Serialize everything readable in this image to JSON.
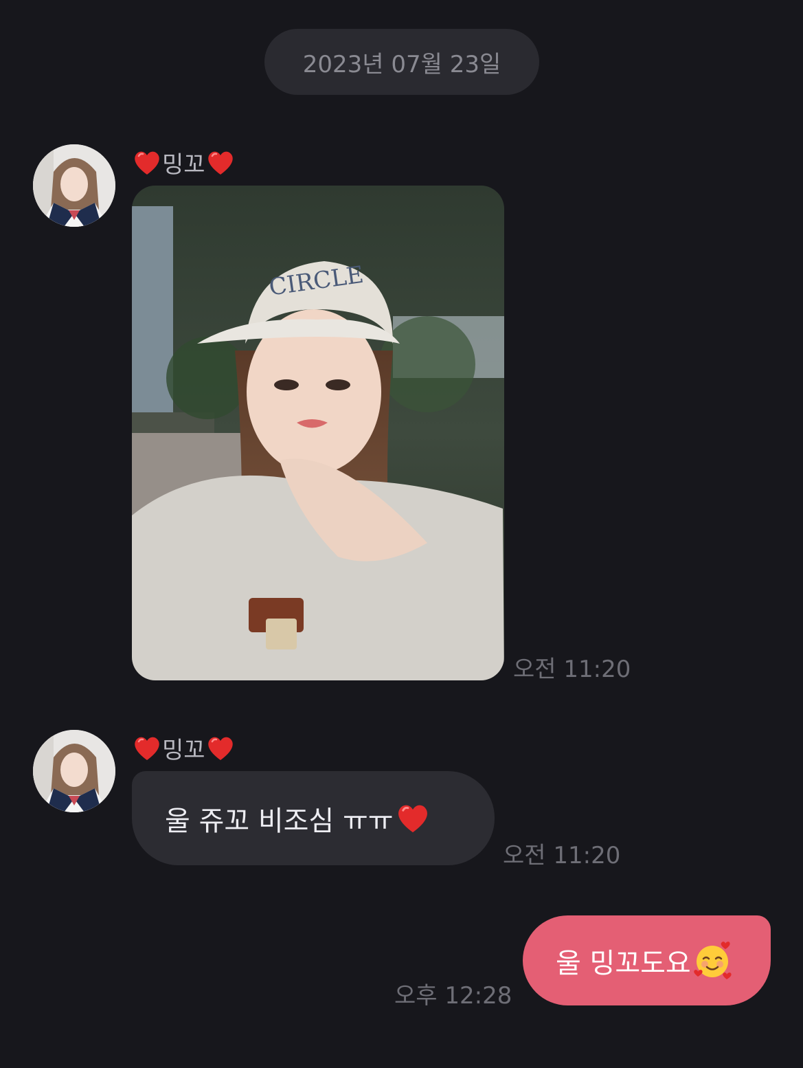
{
  "date_separator": "2023년 07월 23일",
  "messages": [
    {
      "sender": "밍꼬",
      "sender_icons": [
        "red-heart-icon",
        "red-heart-icon"
      ],
      "type": "image",
      "image_description_icon": "photo-thumbnail",
      "time": "오전 11:20"
    },
    {
      "sender": "밍꼬",
      "sender_icons": [
        "red-heart-icon",
        "red-heart-icon"
      ],
      "type": "text",
      "text": "울 쥬꼬 비조심 ㅠㅠ",
      "text_emoji": "red-heart-icon",
      "time": "오전 11:20"
    },
    {
      "sender": "me",
      "type": "text",
      "text": "울 밍꼬도요",
      "text_emoji": "smiling-face-with-hearts-icon",
      "time": "오후 12:28"
    }
  ],
  "colors": {
    "background": "#17171c",
    "incoming_bubble": "#2c2c32",
    "outgoing_bubble": "#e45f74",
    "timestamp": "#6e6e76",
    "date_pill": "#2a2a30"
  }
}
